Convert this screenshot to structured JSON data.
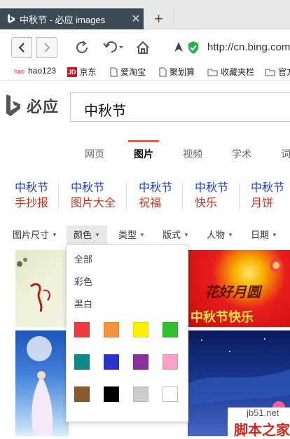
{
  "browser": {
    "tab_title": "中秋节 - 必应 images",
    "close_glyph": "✕",
    "newtab_glyph": "+",
    "url": "http://cn.bing.com"
  },
  "bookmarks": [
    {
      "label": "hao123",
      "icon": "hao123-icon"
    },
    {
      "label": "京东",
      "icon": "jd-icon"
    },
    {
      "label": "爱淘宝",
      "icon": "page-icon"
    },
    {
      "label": "聚划算",
      "icon": "page-icon"
    },
    {
      "label": "收藏夹栏",
      "icon": "folder-icon"
    },
    {
      "label": "官方",
      "icon": "folder-icon"
    }
  ],
  "jd_badge": "JD",
  "bing": {
    "logo_text": "必应",
    "query": "中秋节"
  },
  "scopes": [
    "网页",
    "图片",
    "视频",
    "学术",
    "词"
  ],
  "related": [
    {
      "l1": "中秋节",
      "l2": "手抄报"
    },
    {
      "l1": "中秋节",
      "l2": "图片大全"
    },
    {
      "l1": "中秋节",
      "l2": "祝福"
    },
    {
      "l1": "中秋节",
      "l2": "快乐"
    },
    {
      "l1": "中秋节",
      "l2": "月饼"
    }
  ],
  "filters": [
    "图片尺寸",
    "颜色",
    "类型",
    "版式",
    "人物",
    "日期"
  ],
  "filter_caret": "▼",
  "color_menu": {
    "options": [
      "全部",
      "彩色",
      "黑白"
    ],
    "swatches": [
      "#ef3b3b",
      "#f7943a",
      "#fff200",
      "#2fc12f",
      "#0e8a8a",
      "#2c35c9",
      "#8e2f9e",
      "#f7a1c7",
      "#8a5a2b",
      "#000000",
      "#cccccc",
      "#ffffff"
    ]
  },
  "images": {
    "img2_text": "花好月圆",
    "img2_sub": "中秋节快乐"
  },
  "watermark": {
    "site": "jb51.net",
    "name": "脚本之家"
  },
  "colors": {
    "tab_bg": "#3c4a55",
    "bing_link": "#1a3dc1",
    "bing_related_red": "#c7341f",
    "scope_accent": "#e4624f"
  }
}
